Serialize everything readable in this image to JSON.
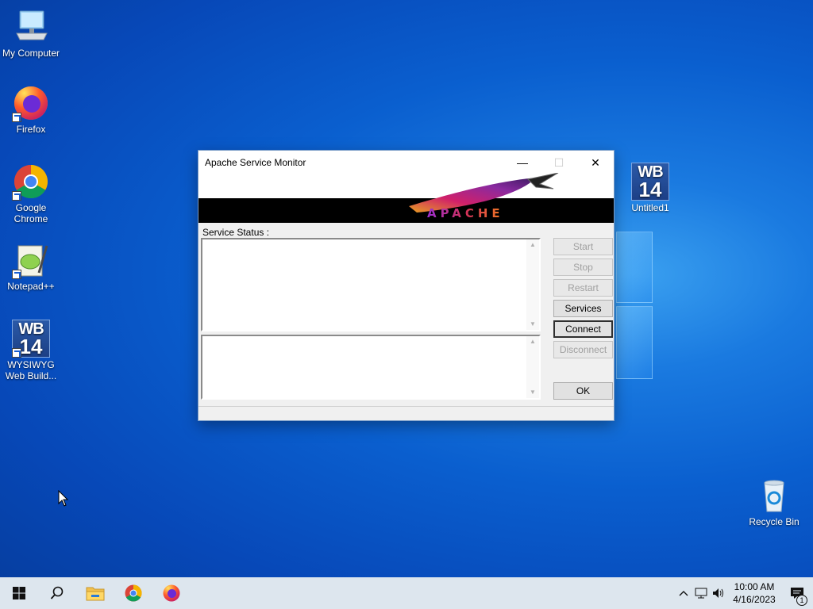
{
  "desktop": {
    "icons": [
      {
        "label": "My Computer",
        "icon": "computer-icon"
      },
      {
        "label": "Firefox",
        "icon": "firefox-icon"
      },
      {
        "label": "Google Chrome",
        "icon": "chrome-icon"
      },
      {
        "label": "Notepad++",
        "icon": "notepadpp-icon"
      },
      {
        "label": "WYSIWYG Web Build...",
        "icon": "wysiwyg-icon"
      },
      {
        "label": "Untitled1",
        "icon": "wysiwyg-icon"
      },
      {
        "label": "Recycle Bin",
        "icon": "recycle-bin-icon"
      }
    ],
    "wb_tile": {
      "line1": "WB",
      "line2": "14"
    }
  },
  "window": {
    "title": "Apache Service Monitor",
    "controls": {
      "minimize": "—",
      "maximize": "☐",
      "close": "✕"
    },
    "banner_text": "APACHE",
    "service_status_label": "Service Status :",
    "buttons": {
      "start": "Start",
      "stop": "Stop",
      "restart": "Restart",
      "services": "Services",
      "connect": "Connect",
      "disconnect": "Disconnect",
      "ok": "OK"
    }
  },
  "taskbar": {
    "pinned": [
      "windows-start-icon",
      "search-icon",
      "file-explorer-icon",
      "chrome-icon",
      "firefox-icon"
    ],
    "tray": {
      "time": "10:00 AM",
      "date": "4/16/2023",
      "notification_count": "1"
    }
  },
  "colors": {
    "desktop_blue": "#0a5fcf",
    "taskbar": "#dde6ee",
    "window_bg": "#f0f0f0"
  }
}
